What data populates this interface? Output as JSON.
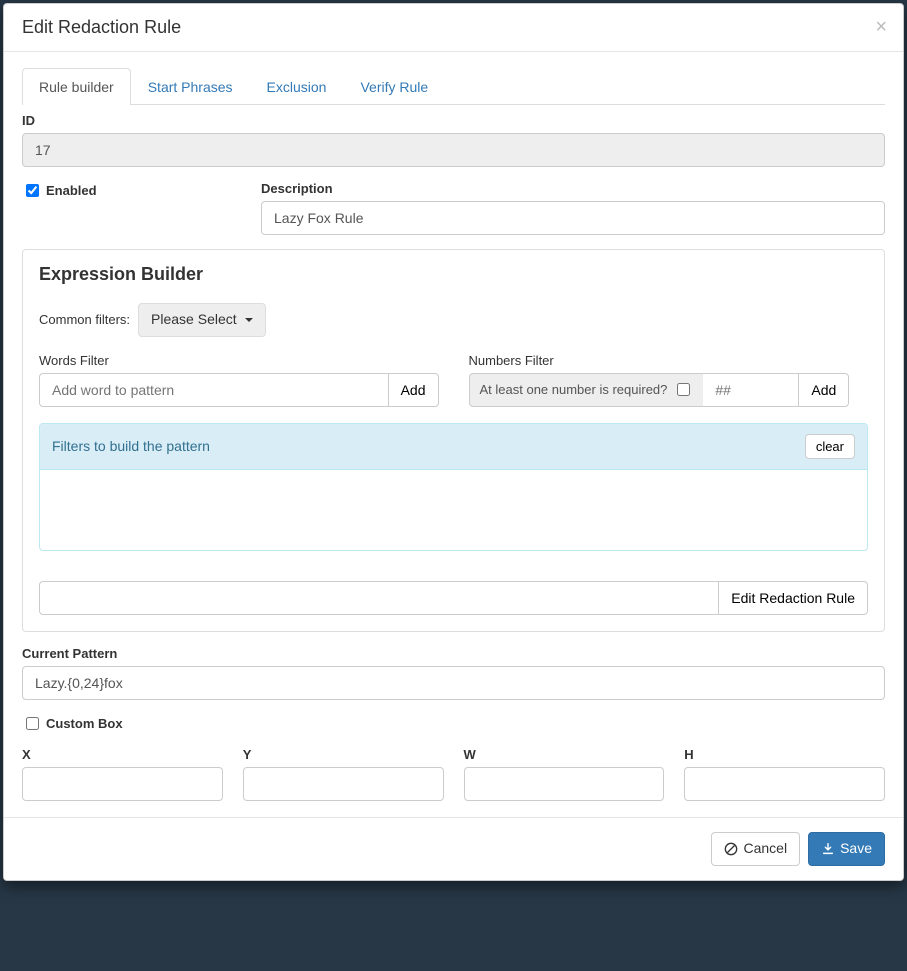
{
  "modal": {
    "title": "Edit Redaction Rule"
  },
  "tabs": {
    "builder": "Rule builder",
    "start": "Start Phrases",
    "exclusion": "Exclusion",
    "verify": "Verify Rule"
  },
  "form": {
    "id_label": "ID",
    "id_value": "17",
    "enabled_label": "Enabled",
    "enabled_checked": true,
    "description_label": "Description",
    "description_value": "Lazy Fox Rule"
  },
  "expression": {
    "title": "Expression Builder",
    "common_filters_label": "Common filters:",
    "common_filters_selected": "Please Select",
    "words_filter_label": "Words Filter",
    "words_filter_placeholder": "Add word to pattern",
    "words_filter_add": "Add",
    "numbers_filter_label": "Numbers Filter",
    "numbers_required_label": "At least one number is required?",
    "numbers_placeholder": "##",
    "numbers_add": "Add",
    "pattern_panel_title": "Filters to build the pattern",
    "clear_button": "clear",
    "edit_rule_button": "Edit Redaction Rule"
  },
  "pattern": {
    "label": "Current Pattern",
    "value": "Lazy.{0,24}fox"
  },
  "custom_box": {
    "label": "Custom Box",
    "checked": false,
    "x_label": "X",
    "y_label": "Y",
    "w_label": "W",
    "h_label": "H"
  },
  "footer": {
    "cancel": "Cancel",
    "save": "Save"
  }
}
